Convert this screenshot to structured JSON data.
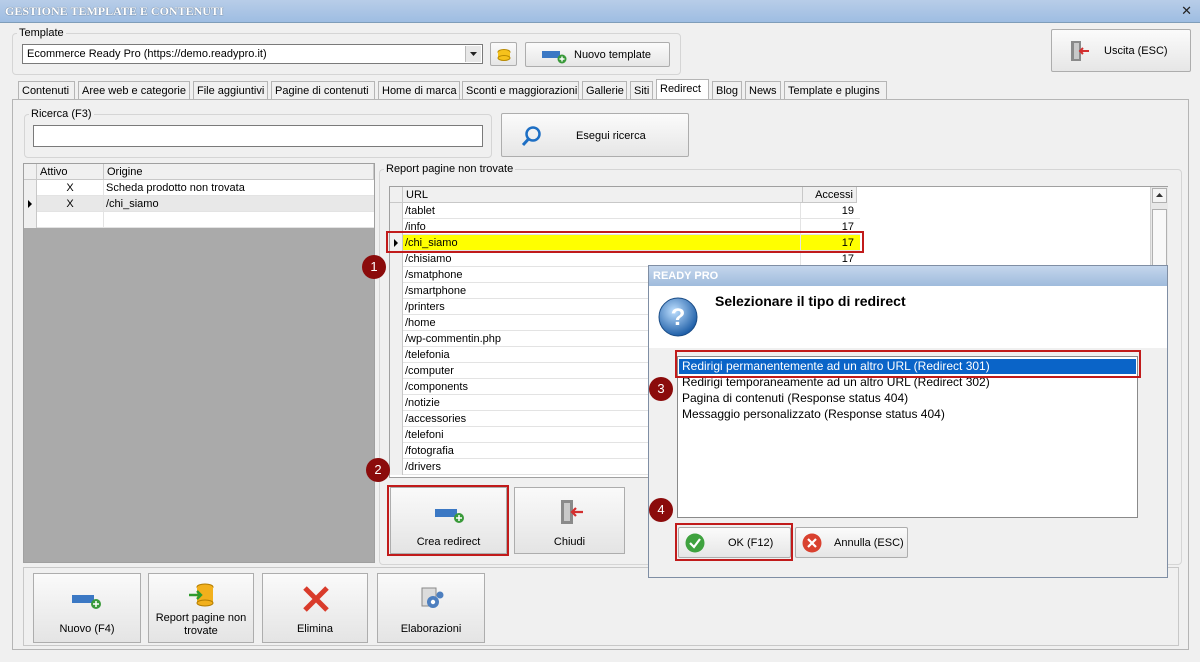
{
  "window": {
    "title": "GESTIONE TEMPLATE E CONTENUTI",
    "close": "✕"
  },
  "template": {
    "legend": "Template",
    "selected": "Ecommerce Ready Pro (https://demo.readypro.it)",
    "new_button": "Nuovo template"
  },
  "exit_button": "Uscita (ESC)",
  "tabs": [
    "Contenuti",
    "Aree web e categorie",
    "File aggiuntivi",
    "Pagine di contenuti",
    "Home di marca",
    "Sconti e maggiorazioni",
    "Gallerie",
    "Siti",
    "Redirect",
    "Blog",
    "News",
    "Template e plugins"
  ],
  "active_tab": "Redirect",
  "search": {
    "legend": "Ricerca (F3)",
    "value": "",
    "button": "Esegui ricerca"
  },
  "redirect_grid": {
    "columns": [
      "Attivo",
      "Origine"
    ],
    "rows": [
      {
        "attivo": "X",
        "origine": "Scheda prodotto non trovata"
      },
      {
        "attivo": "X",
        "origine": "/chi_siamo"
      }
    ]
  },
  "report": {
    "legend": "Report pagine non trovate",
    "columns": [
      "URL",
      "Accessi"
    ],
    "rows": [
      {
        "url": "/tablet",
        "accessi": "19"
      },
      {
        "url": "/info",
        "accessi": "17"
      },
      {
        "url": "/chi_siamo",
        "accessi": "17"
      },
      {
        "url": "/chisiamo",
        "accessi": "17"
      },
      {
        "url": "/smatphone",
        "accessi": ""
      },
      {
        "url": "/smartphone",
        "accessi": ""
      },
      {
        "url": "/printers",
        "accessi": ""
      },
      {
        "url": "/home",
        "accessi": ""
      },
      {
        "url": "/wp-commentin.php",
        "accessi": ""
      },
      {
        "url": "/telefonia",
        "accessi": ""
      },
      {
        "url": "/computer",
        "accessi": ""
      },
      {
        "url": "/components",
        "accessi": ""
      },
      {
        "url": "/notizie",
        "accessi": ""
      },
      {
        "url": "/accessories",
        "accessi": ""
      },
      {
        "url": "/telefoni",
        "accessi": ""
      },
      {
        "url": "/fotografia",
        "accessi": ""
      },
      {
        "url": "/drivers",
        "accessi": ""
      }
    ],
    "create_button": "Crea redirect",
    "close_button": "Chiudi"
  },
  "dialog": {
    "title": "READY PRO",
    "heading": "Selezionare il tipo di redirect",
    "options": [
      "Redirigi permanentemente ad un altro URL (Redirect 301)",
      "Redirigi temporaneamente ad un altro URL (Redirect 302)",
      "Pagina di contenuti (Response status 404)",
      "Messaggio personalizzato (Response status 404)"
    ],
    "ok": "OK (F12)",
    "cancel": "Annulla (ESC)"
  },
  "bottom_buttons": {
    "new": "Nuovo (F4)",
    "report_line1": "Report pagine non",
    "report_line2": "trovate",
    "delete": "Elimina",
    "processing": "Elaborazioni"
  },
  "callouts": [
    "1",
    "2",
    "3",
    "4"
  ],
  "colors": {
    "highlight": "#ffff00",
    "selection": "#0a64c8",
    "callout": "#8b0b0b",
    "redbox": "#c11b1b"
  }
}
